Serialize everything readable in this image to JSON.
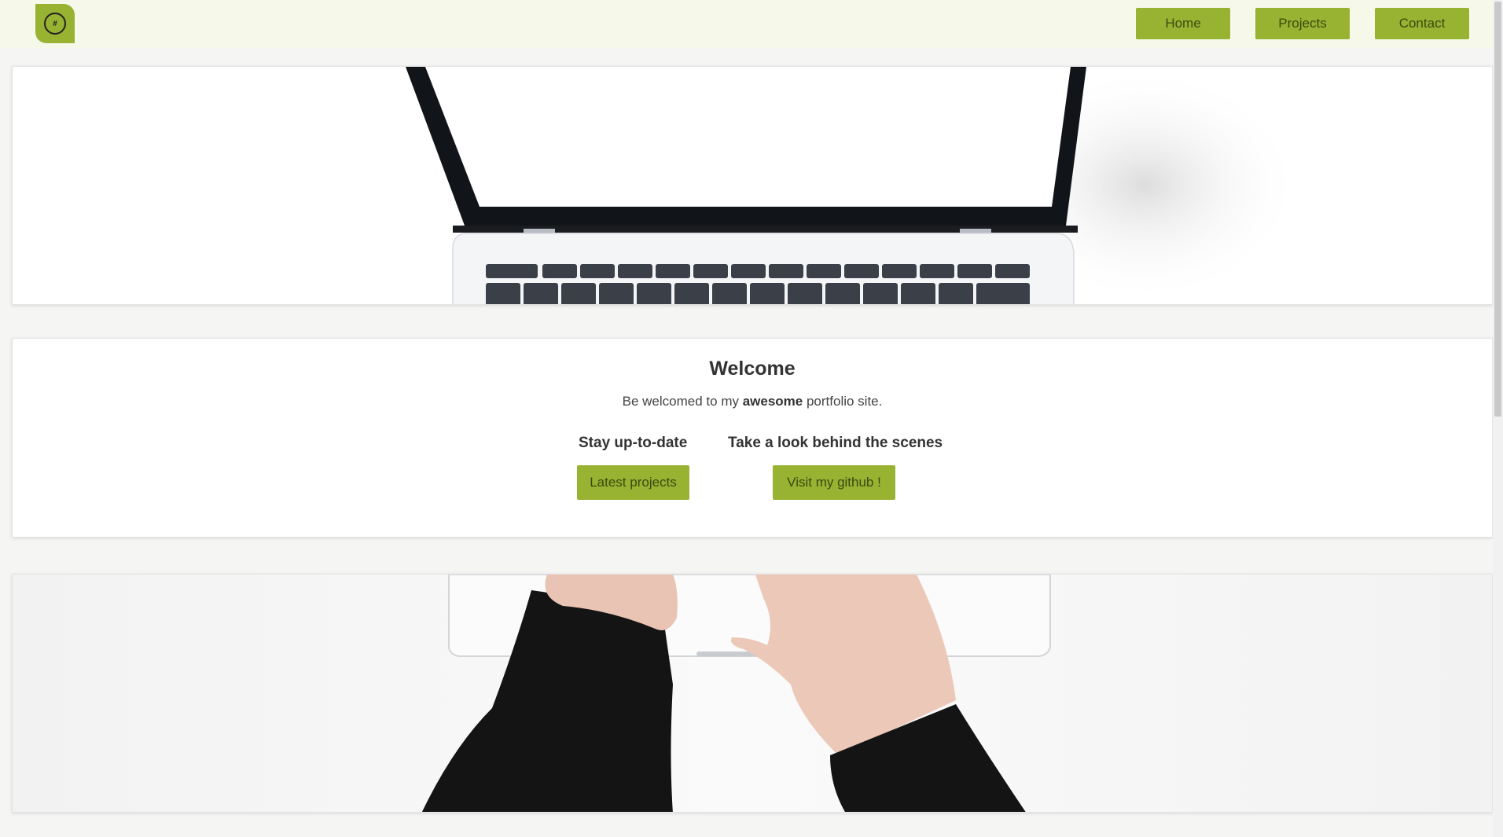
{
  "header": {
    "logo_symbol": "#",
    "nav": [
      {
        "label": "Home"
      },
      {
        "label": "Projects"
      },
      {
        "label": "Contact"
      }
    ]
  },
  "welcome": {
    "title": "Welcome",
    "text_before": "Be welcomed to my ",
    "text_bold": "awesome",
    "text_after": " portfolio site.",
    "columns": [
      {
        "heading": "Stay up-to-date",
        "button": "Latest projects"
      },
      {
        "heading": "Take a look behind the scenes",
        "button": "Visit my github !"
      }
    ]
  },
  "images": {
    "top": "laptop-screen-photo",
    "bottom": "hands-on-laptop-photo"
  },
  "colors": {
    "accent": "#98b232",
    "header_bg": "#f6f8ea",
    "button_text": "#3b4a10"
  }
}
